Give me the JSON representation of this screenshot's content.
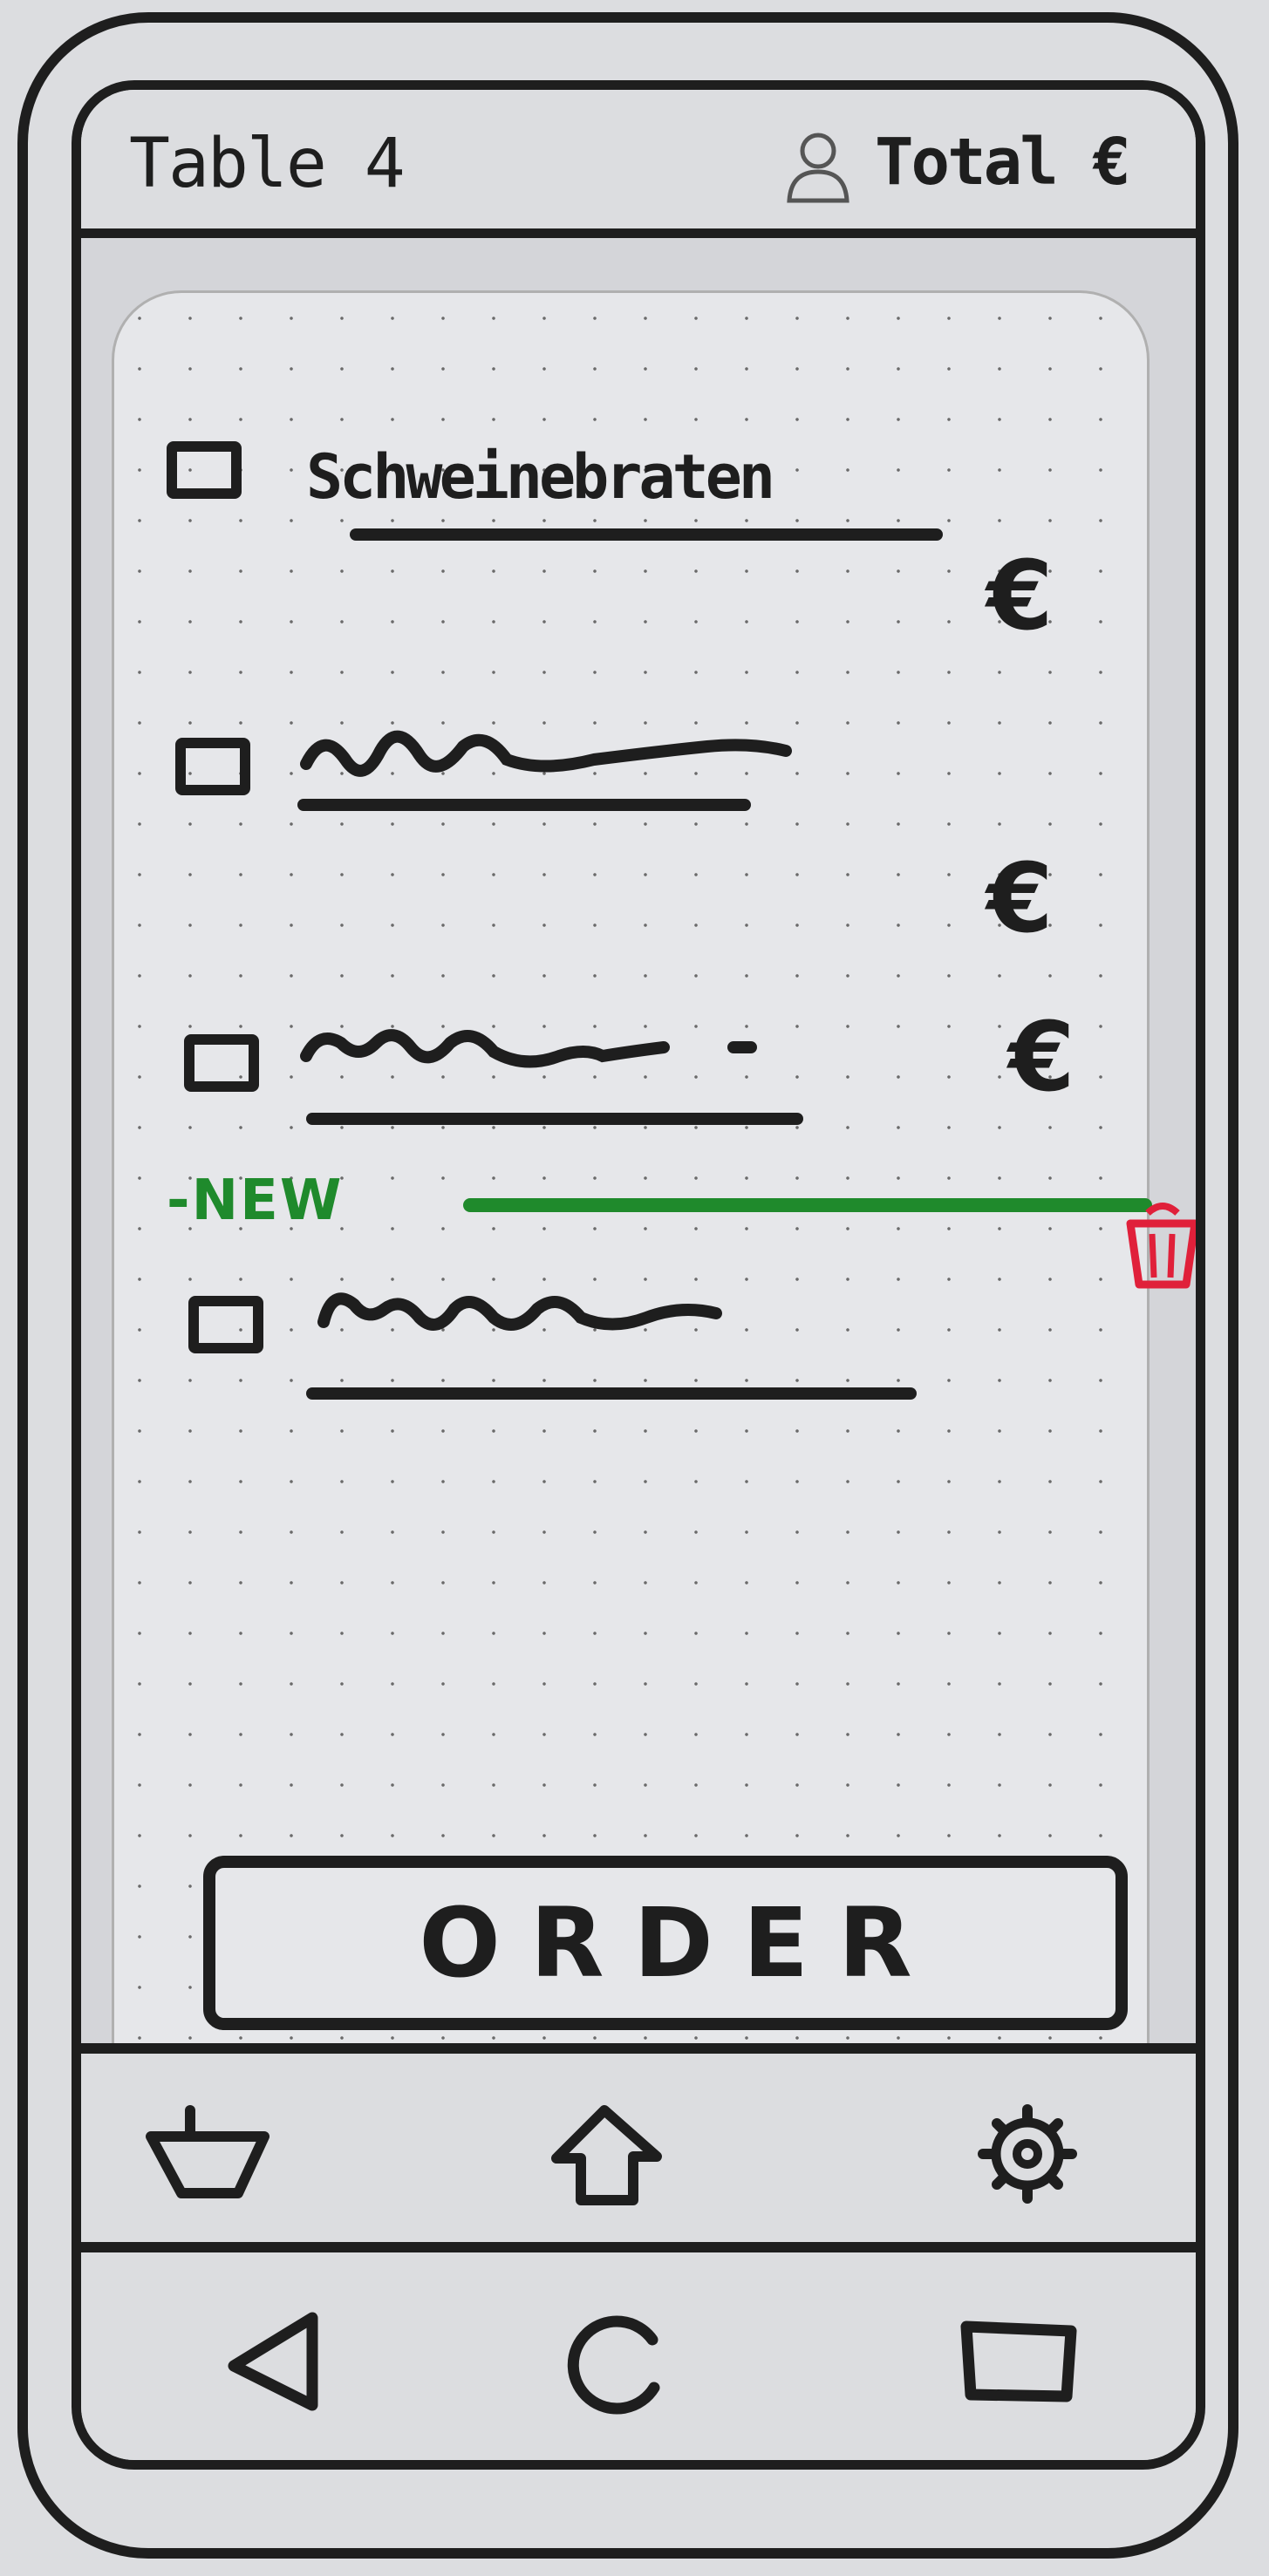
{
  "header": {
    "title": "Table 4",
    "total_label": "Total €"
  },
  "items": [
    {
      "name": "Schweinebraten",
      "price": "€"
    },
    {
      "name": "",
      "price": "€"
    },
    {
      "name": "",
      "price": "€"
    }
  ],
  "new_section": {
    "label": "-NEW",
    "items": [
      {
        "name": ""
      }
    ]
  },
  "order_button": {
    "label": "ORDER"
  },
  "colors": {
    "ink": "#1e1e1e",
    "new_accent": "#1f8a2c",
    "trash": "#e0203a"
  },
  "bottom_nav": {
    "icons": [
      "basket-icon",
      "home-icon",
      "gear-icon"
    ]
  },
  "system_nav": {
    "icons": [
      "back-icon",
      "home-circle-icon",
      "recents-icon"
    ]
  }
}
